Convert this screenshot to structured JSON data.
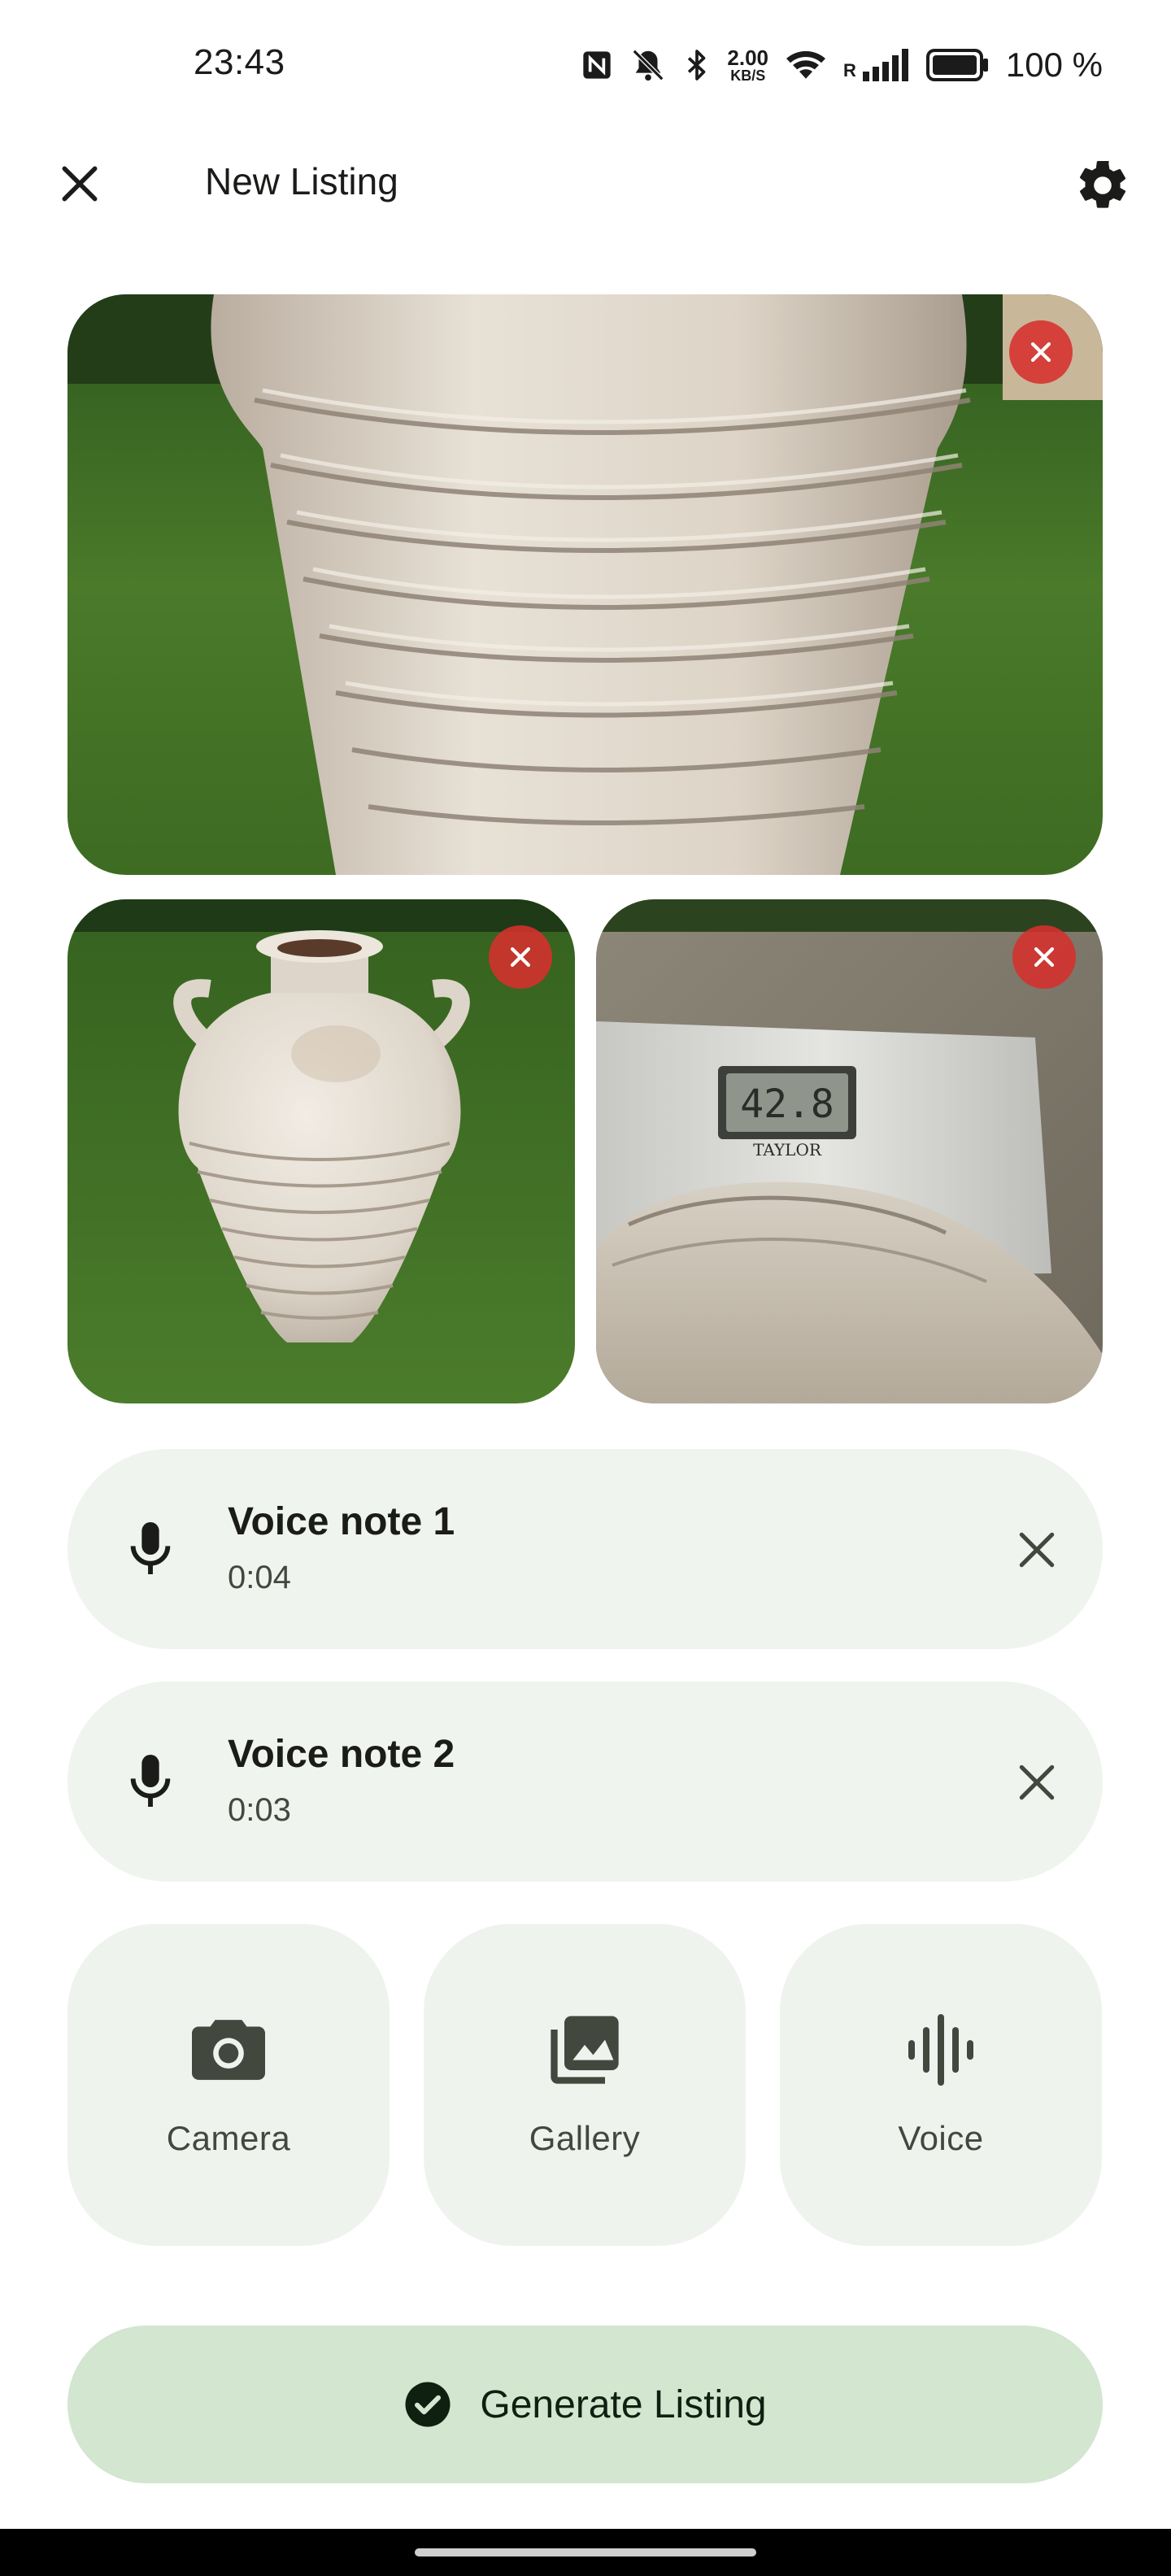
{
  "status_bar": {
    "time": "23:43",
    "net_speed_value": "2.00",
    "net_speed_unit": "KB/S",
    "roaming_label": "R",
    "battery": "100 %",
    "icons": [
      "nfc-icon",
      "vibrate-off-icon",
      "bluetooth-icon",
      "wifi-icon",
      "cell-signal-icon",
      "battery-icon"
    ]
  },
  "top_bar": {
    "title": "New Listing",
    "close_icon": "close-icon",
    "settings_icon": "gear-icon"
  },
  "photos": {
    "items": [
      {
        "subject": "ribbed white clay urn, close-up"
      },
      {
        "subject": "white amphora vase on lawn"
      },
      {
        "subject": "vase on bathroom scale"
      }
    ],
    "scale_reading": "42.8",
    "scale_brand": "TAYLOR",
    "remove_icon": "close-icon"
  },
  "voice_notes": [
    {
      "title": "Voice note 1",
      "duration": "0:04"
    },
    {
      "title": "Voice note 2",
      "duration": "0:03"
    }
  ],
  "actions": [
    {
      "label": "Camera",
      "icon": "camera-icon"
    },
    {
      "label": "Gallery",
      "icon": "gallery-icon"
    },
    {
      "label": "Voice",
      "icon": "waveform-icon"
    }
  ],
  "generate": {
    "label": "Generate Listing",
    "icon": "check-circle-icon"
  },
  "colors": {
    "voice_note_bg": "#eff4ee",
    "tile_bg": "#eff3ee",
    "generate_bg": "#d2e6d0",
    "remove_badge": "#d6302c"
  }
}
